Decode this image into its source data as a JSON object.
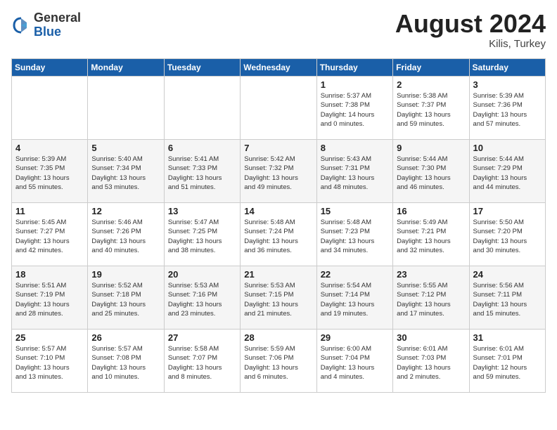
{
  "header": {
    "logo_general": "General",
    "logo_blue": "Blue",
    "month_year": "August 2024",
    "location": "Kilis, Turkey"
  },
  "weekdays": [
    "Sunday",
    "Monday",
    "Tuesday",
    "Wednesday",
    "Thursday",
    "Friday",
    "Saturday"
  ],
  "weeks": [
    [
      {
        "day": "",
        "info": ""
      },
      {
        "day": "",
        "info": ""
      },
      {
        "day": "",
        "info": ""
      },
      {
        "day": "",
        "info": ""
      },
      {
        "day": "1",
        "info": "Sunrise: 5:37 AM\nSunset: 7:38 PM\nDaylight: 14 hours\nand 0 minutes."
      },
      {
        "day": "2",
        "info": "Sunrise: 5:38 AM\nSunset: 7:37 PM\nDaylight: 13 hours\nand 59 minutes."
      },
      {
        "day": "3",
        "info": "Sunrise: 5:39 AM\nSunset: 7:36 PM\nDaylight: 13 hours\nand 57 minutes."
      }
    ],
    [
      {
        "day": "4",
        "info": "Sunrise: 5:39 AM\nSunset: 7:35 PM\nDaylight: 13 hours\nand 55 minutes."
      },
      {
        "day": "5",
        "info": "Sunrise: 5:40 AM\nSunset: 7:34 PM\nDaylight: 13 hours\nand 53 minutes."
      },
      {
        "day": "6",
        "info": "Sunrise: 5:41 AM\nSunset: 7:33 PM\nDaylight: 13 hours\nand 51 minutes."
      },
      {
        "day": "7",
        "info": "Sunrise: 5:42 AM\nSunset: 7:32 PM\nDaylight: 13 hours\nand 49 minutes."
      },
      {
        "day": "8",
        "info": "Sunrise: 5:43 AM\nSunset: 7:31 PM\nDaylight: 13 hours\nand 48 minutes."
      },
      {
        "day": "9",
        "info": "Sunrise: 5:44 AM\nSunset: 7:30 PM\nDaylight: 13 hours\nand 46 minutes."
      },
      {
        "day": "10",
        "info": "Sunrise: 5:44 AM\nSunset: 7:29 PM\nDaylight: 13 hours\nand 44 minutes."
      }
    ],
    [
      {
        "day": "11",
        "info": "Sunrise: 5:45 AM\nSunset: 7:27 PM\nDaylight: 13 hours\nand 42 minutes."
      },
      {
        "day": "12",
        "info": "Sunrise: 5:46 AM\nSunset: 7:26 PM\nDaylight: 13 hours\nand 40 minutes."
      },
      {
        "day": "13",
        "info": "Sunrise: 5:47 AM\nSunset: 7:25 PM\nDaylight: 13 hours\nand 38 minutes."
      },
      {
        "day": "14",
        "info": "Sunrise: 5:48 AM\nSunset: 7:24 PM\nDaylight: 13 hours\nand 36 minutes."
      },
      {
        "day": "15",
        "info": "Sunrise: 5:48 AM\nSunset: 7:23 PM\nDaylight: 13 hours\nand 34 minutes."
      },
      {
        "day": "16",
        "info": "Sunrise: 5:49 AM\nSunset: 7:21 PM\nDaylight: 13 hours\nand 32 minutes."
      },
      {
        "day": "17",
        "info": "Sunrise: 5:50 AM\nSunset: 7:20 PM\nDaylight: 13 hours\nand 30 minutes."
      }
    ],
    [
      {
        "day": "18",
        "info": "Sunrise: 5:51 AM\nSunset: 7:19 PM\nDaylight: 13 hours\nand 28 minutes."
      },
      {
        "day": "19",
        "info": "Sunrise: 5:52 AM\nSunset: 7:18 PM\nDaylight: 13 hours\nand 25 minutes."
      },
      {
        "day": "20",
        "info": "Sunrise: 5:53 AM\nSunset: 7:16 PM\nDaylight: 13 hours\nand 23 minutes."
      },
      {
        "day": "21",
        "info": "Sunrise: 5:53 AM\nSunset: 7:15 PM\nDaylight: 13 hours\nand 21 minutes."
      },
      {
        "day": "22",
        "info": "Sunrise: 5:54 AM\nSunset: 7:14 PM\nDaylight: 13 hours\nand 19 minutes."
      },
      {
        "day": "23",
        "info": "Sunrise: 5:55 AM\nSunset: 7:12 PM\nDaylight: 13 hours\nand 17 minutes."
      },
      {
        "day": "24",
        "info": "Sunrise: 5:56 AM\nSunset: 7:11 PM\nDaylight: 13 hours\nand 15 minutes."
      }
    ],
    [
      {
        "day": "25",
        "info": "Sunrise: 5:57 AM\nSunset: 7:10 PM\nDaylight: 13 hours\nand 13 minutes."
      },
      {
        "day": "26",
        "info": "Sunrise: 5:57 AM\nSunset: 7:08 PM\nDaylight: 13 hours\nand 10 minutes."
      },
      {
        "day": "27",
        "info": "Sunrise: 5:58 AM\nSunset: 7:07 PM\nDaylight: 13 hours\nand 8 minutes."
      },
      {
        "day": "28",
        "info": "Sunrise: 5:59 AM\nSunset: 7:06 PM\nDaylight: 13 hours\nand 6 minutes."
      },
      {
        "day": "29",
        "info": "Sunrise: 6:00 AM\nSunset: 7:04 PM\nDaylight: 13 hours\nand 4 minutes."
      },
      {
        "day": "30",
        "info": "Sunrise: 6:01 AM\nSunset: 7:03 PM\nDaylight: 13 hours\nand 2 minutes."
      },
      {
        "day": "31",
        "info": "Sunrise: 6:01 AM\nSunset: 7:01 PM\nDaylight: 12 hours\nand 59 minutes."
      }
    ]
  ]
}
